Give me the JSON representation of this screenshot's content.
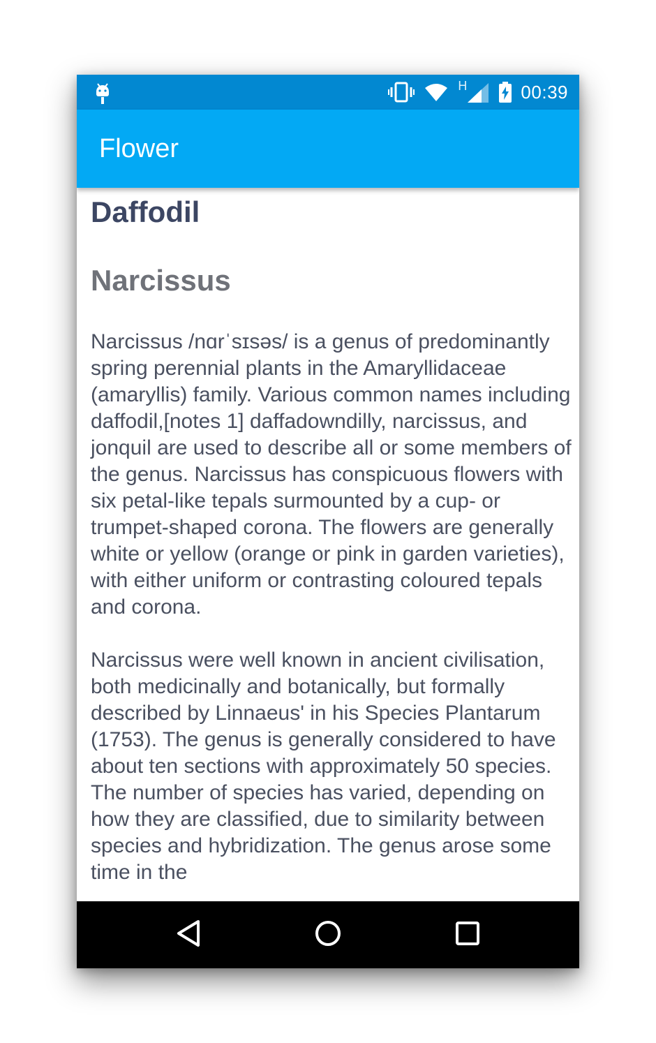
{
  "status_bar": {
    "time": "00:39",
    "network_label": "H",
    "icons": [
      "android-debug-icon",
      "vibrate-icon",
      "wifi-icon",
      "cell-signal-icon",
      "battery-charging-icon"
    ]
  },
  "app_bar": {
    "title": "Flower"
  },
  "flower": {
    "name": "Daffodil",
    "genus": "Narcissus",
    "description": "Narcissus /nɑrˈsɪsəs/ is a genus of predominantly spring perennial plants in the Amaryllidaceae (amaryllis) family. Various common names including daffodil,[notes 1] daffadowndilly, narcissus, and jonquil are used to describe all or some members of the genus. Narcissus has conspicuous flowers with six petal-like tepals surmounted by a cup- or trumpet-shaped corona. The flowers are generally white or yellow (orange or pink in garden varieties), with either uniform or contrasting coloured tepals and corona.\n\nNarcissus were well known in ancient civilisation, both medicinally and botanically, but formally described by Linnaeus' in his Species Plantarum (1753). The genus is generally considered to have about ten sections with approximately 50 species. The number of species has varied, depending on how they are classified, due to similarity between species and hybridization. The genus arose some time in the"
  },
  "nav_bar": {
    "buttons": [
      "back-icon",
      "home-icon",
      "recents-icon"
    ]
  },
  "colors": {
    "status_bar": "#0288d1",
    "app_bar": "#03a9f4",
    "name_text": "#3c4663",
    "genus_text": "#6f7279",
    "body_text": "#4a5060"
  }
}
